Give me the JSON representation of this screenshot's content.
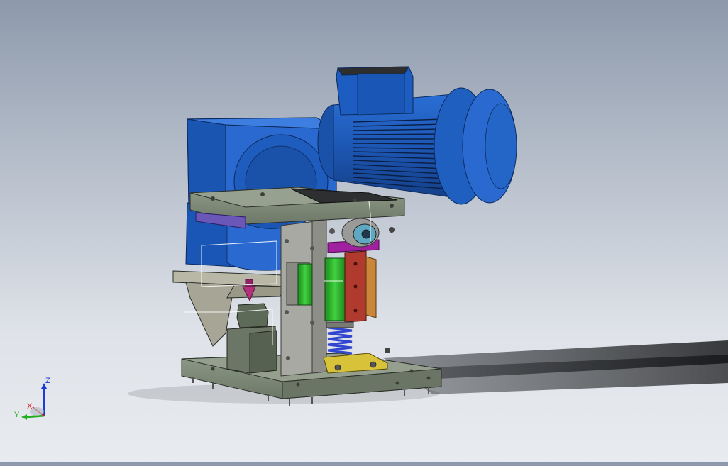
{
  "view": {
    "background_top": "#8d99ab",
    "background_bottom": "#e8ebef"
  },
  "model": {
    "parts": [
      "motor",
      "terminal-box",
      "gearbox",
      "top-plate",
      "side-column",
      "base-plate",
      "lower-bracket",
      "cylinder-block",
      "green-slider",
      "red-block",
      "orange-plate",
      "spring",
      "yellow-bracket",
      "bearing",
      "pink-cone",
      "guide-block"
    ],
    "colors": {
      "motor": "#1f5fc0",
      "motor_dark": "#123f8a",
      "plate": "#7f8c7a",
      "column": "#a9a9a3",
      "green": "#2fb62f",
      "red": "#b03a2e",
      "orange": "#c9873a",
      "yellow": "#d8c23a",
      "spring": "#3045d0",
      "purple": "#6a57b8",
      "magenta": "#a020a0"
    }
  },
  "triad": {
    "z_label": "Z",
    "y_label": "Y",
    "x_label": "X",
    "z_color": "#1a3cd8",
    "y_color": "#22b022",
    "x_color": "#d82020"
  }
}
